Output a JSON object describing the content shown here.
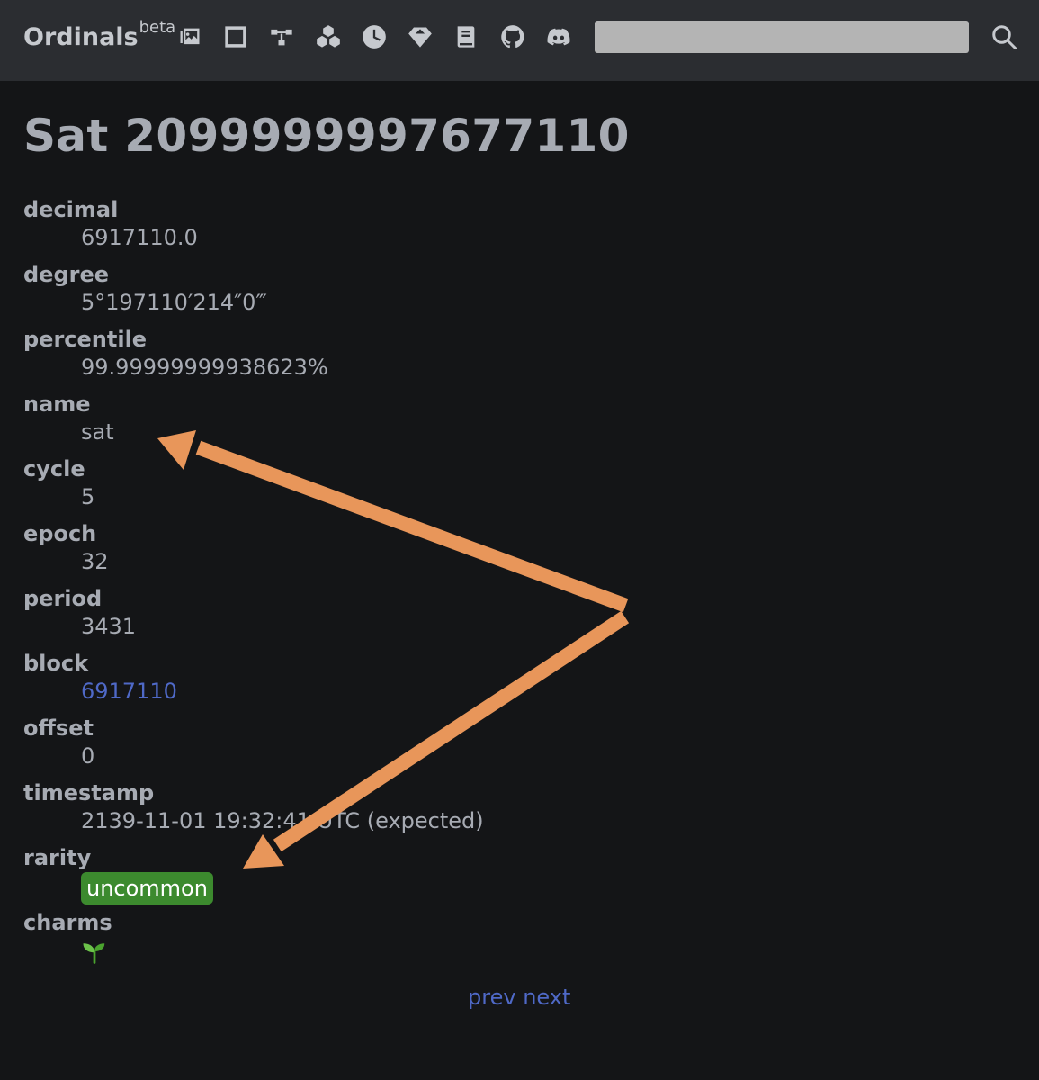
{
  "header": {
    "logo_text": "Ordinals",
    "logo_sup": "beta",
    "nav_icons": [
      {
        "name": "collections-icon"
      },
      {
        "name": "inscriptions-icon"
      },
      {
        "name": "runes-icon"
      },
      {
        "name": "blocks-icon"
      },
      {
        "name": "clock-icon"
      },
      {
        "name": "rare-sats-icon"
      },
      {
        "name": "handbook-icon"
      },
      {
        "name": "github-icon"
      },
      {
        "name": "discord-icon"
      }
    ],
    "search": {
      "value": "",
      "placeholder": "",
      "icon": "search-icon"
    }
  },
  "page_title": "Sat 2099999997677110",
  "details": {
    "decimal": {
      "label": "decimal",
      "value": "6917110.0"
    },
    "degree": {
      "label": "degree",
      "value": "5°197110′214″0‴"
    },
    "percentile": {
      "label": "percentile",
      "value": "99.99999999938623%"
    },
    "name": {
      "label": "name",
      "value": "sat"
    },
    "cycle": {
      "label": "cycle",
      "value": "5"
    },
    "epoch": {
      "label": "epoch",
      "value": "32"
    },
    "period": {
      "label": "period",
      "value": "3431"
    },
    "block": {
      "label": "block",
      "value": "6917110"
    },
    "offset": {
      "label": "offset",
      "value": "0"
    },
    "timestamp": {
      "label": "timestamp",
      "value": "2139-11-01 19:32:41 UTC (expected)"
    },
    "rarity": {
      "label": "rarity",
      "value": "uncommon"
    },
    "charms": {
      "label": "charms",
      "icon": "sprout-icon"
    }
  },
  "pager": {
    "prev": "prev",
    "next": "next"
  },
  "colors": {
    "background": "#141517",
    "header": "#2b2d31",
    "text": "#a7abb3",
    "link": "#4f69c7",
    "rarity_uncommon": "#3c8a2e",
    "annotation_arrow": "#e8965a"
  }
}
